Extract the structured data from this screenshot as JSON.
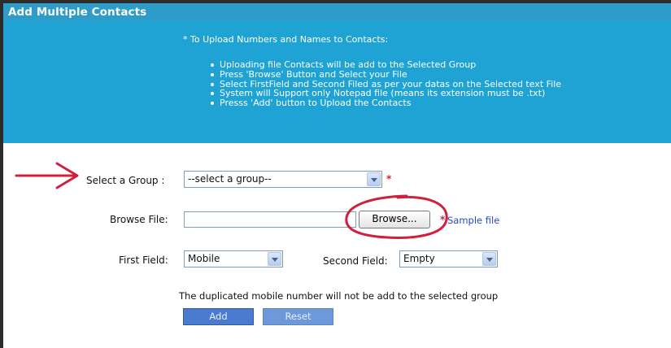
{
  "title": "Add Multiple Contacts",
  "info": {
    "heading": "* To Upload Numbers and Names to Contacts:",
    "items": [
      "Uploading file Contacts will be add to the Selected Group",
      "Press 'Browse' Button and Select your File",
      "Select FirstField and Second Filed as per your datas on the Selected text File",
      "System will Support only Notepad file (means its extension must be .txt)",
      "Presss 'Add' button to Upload the Contacts"
    ]
  },
  "form": {
    "group_label": "Select a Group :",
    "group_value": "--select a group--",
    "browse_label": "Browse File:",
    "browse_value": "",
    "browse_button": "Browse...",
    "sample_link": "Sample file",
    "required_mark": "*",
    "first_field_label": "First Field:",
    "first_field_value": "Mobile",
    "second_field_label": "Second Field:",
    "second_field_value": "Empty",
    "note": "The duplicated mobile number will not be add to the selected group",
    "add_button": "Add",
    "reset_button": "Reset"
  },
  "annotations": {
    "arrow_color": "#d0213c",
    "circle_color": "#d0213c"
  },
  "colors": {
    "header_blue": "#2d9cc9",
    "panel_blue": "#1fa3d4",
    "button_blue": "#4a7bd0"
  }
}
